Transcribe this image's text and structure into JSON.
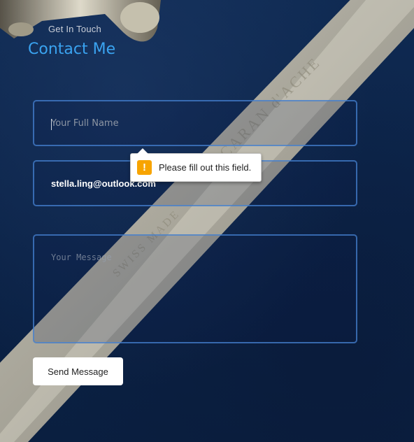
{
  "header": {
    "subtitle": "Get In Touch",
    "title": "Contact Me"
  },
  "form": {
    "name": {
      "value": "",
      "placeholder": "Your Full Name"
    },
    "email": {
      "value": "stella.ling@outlook.com",
      "placeholder": ""
    },
    "message": {
      "value": "",
      "placeholder": "Your Message"
    },
    "send_label": "Send Message"
  },
  "validation": {
    "icon": "warning-icon",
    "icon_glyph": "!",
    "message": "Please fill out this field."
  },
  "background": {
    "pen_engraving_1": "CARAN d'ACHE",
    "pen_engraving_2": "SWISS MADE",
    "colors": {
      "accent": "#3aa3f0",
      "field_border": "#4682d2",
      "warning": "#f7a400"
    }
  }
}
